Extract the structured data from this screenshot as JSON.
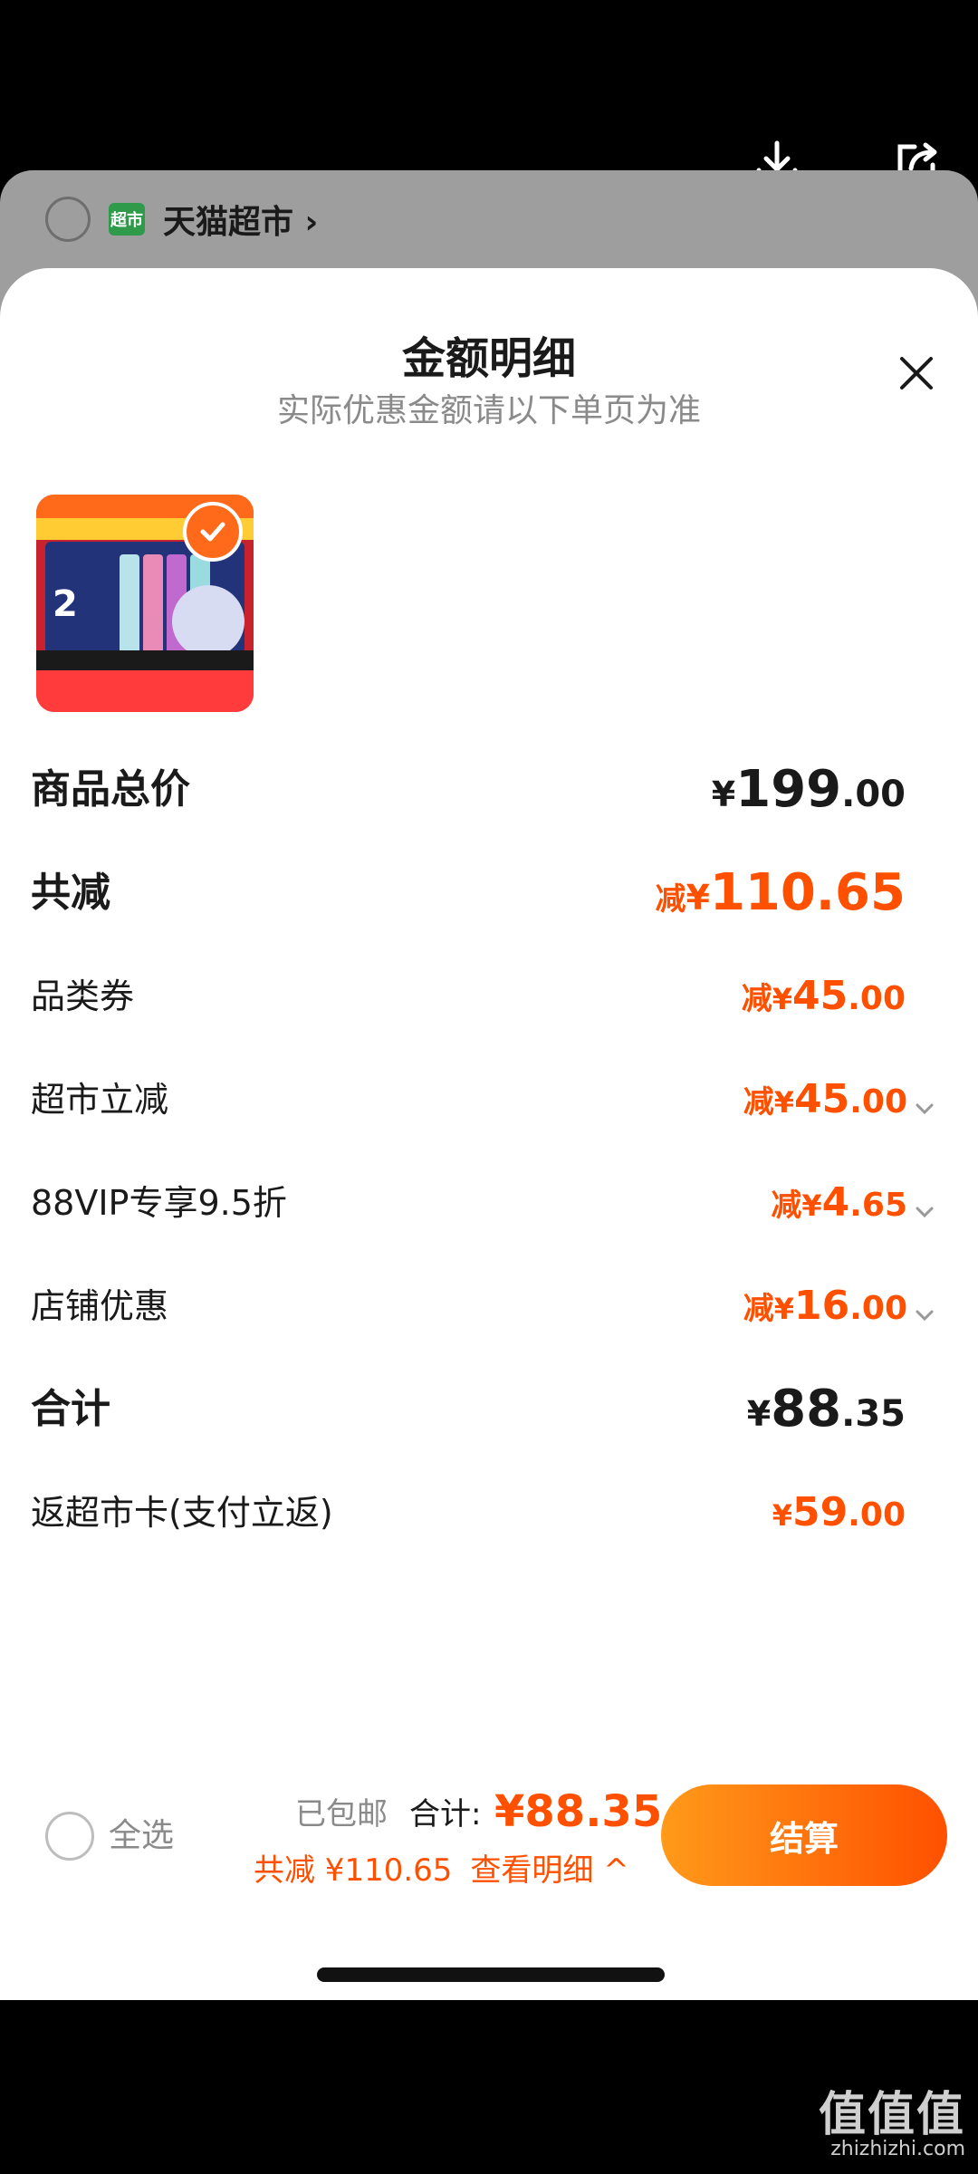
{
  "underlay": {
    "store_name": "天猫超市 ›",
    "store_badge": "超市"
  },
  "sheet": {
    "title": "金额明细",
    "subtitle": "实际优惠金额请以下单页为准"
  },
  "rows": {
    "total_price": {
      "label": "商品总价",
      "yen": "¥",
      "int": "199",
      "dec": ".00"
    },
    "total_reduce": {
      "label": "共减",
      "pre": "减",
      "yen": "¥",
      "int": "110.65",
      "dec": ""
    },
    "category_coupon": {
      "label": "品类券",
      "pre": "减",
      "yen": "¥",
      "int": "45",
      "dec": ".00"
    },
    "market_reduce": {
      "label": "超市立减",
      "pre": "减",
      "yen": "¥",
      "int": "45",
      "dec": ".00"
    },
    "vip": {
      "label": "88VIP专享9.5折",
      "pre": "减",
      "yen": "¥",
      "int": "4",
      "dec": ".65"
    },
    "store_discount": {
      "label": "店铺优惠",
      "pre": "减",
      "yen": "¥",
      "int": "16",
      "dec": ".00"
    },
    "sum": {
      "label": "合计",
      "yen": "¥",
      "int": "88",
      "dec": ".35"
    },
    "cashback": {
      "label": "返超市卡(支付立返)",
      "yen": "¥",
      "int": "59",
      "dec": ".00"
    }
  },
  "bottom": {
    "select_all": "全选",
    "shipping": "已包邮",
    "total_label": "合计:",
    "total_value": "¥88.35",
    "savings": "共减 ¥110.65",
    "view_detail": "查看明细 ^",
    "checkout": "结算"
  },
  "watermark": {
    "main": "值值值",
    "url": "zhizhizhi.com"
  },
  "colors": {
    "accent": "#ff5000",
    "text": "#1a1a1a",
    "muted": "#8a8a8a"
  },
  "icons": [
    "download-icon",
    "share-icon",
    "close-icon",
    "checkmark-icon",
    "chevron-down-icon"
  ]
}
